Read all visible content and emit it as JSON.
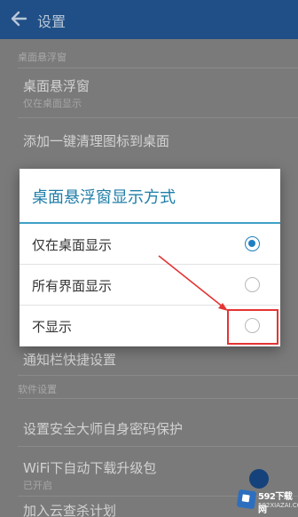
{
  "app_bar": {
    "title": "设置",
    "back_icon": "back-arrow-icon"
  },
  "settings": {
    "section_1_header": "桌面悬浮窗",
    "row_float_window": {
      "title": "桌面悬浮窗",
      "subtitle": "仅在桌面显示"
    },
    "row_add_shortcut": {
      "title": "添加一键清理图标到桌面"
    },
    "row_hidden": {
      "title": "通知栏快捷设置"
    },
    "section_2_header": "软件设置",
    "row_security": {
      "title": "设置安全大师自身密码保护"
    },
    "row_wifi": {
      "title": "WiFi下自动下载升级包",
      "subtitle": "已开启"
    },
    "row_join": {
      "title": "加入云查杀计划"
    }
  },
  "dialog": {
    "title": "桌面悬浮窗显示方式",
    "options": [
      {
        "label": "仅在桌面显示",
        "selected": true
      },
      {
        "label": "所有界面显示",
        "selected": false
      },
      {
        "label": "不显示",
        "selected": false
      }
    ]
  },
  "annotation": {
    "color": "#e43434"
  },
  "watermark": {
    "brand": "592下载网",
    "sub": "592XIAZAI.COM"
  }
}
